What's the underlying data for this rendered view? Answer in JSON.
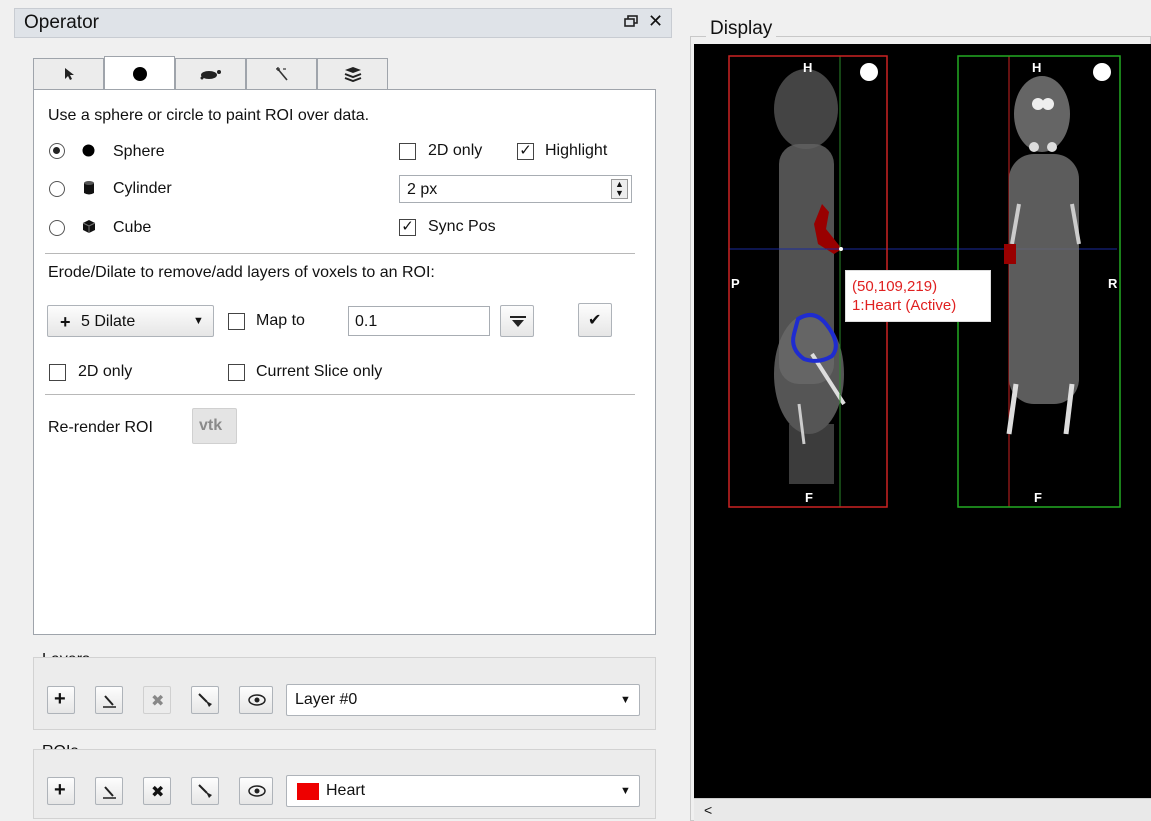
{
  "operator": {
    "title": "Operator",
    "float_icon": "ᴕ",
    "close_icon": "✕",
    "tabs": [
      "pointer-icon",
      "sphere-brush-icon",
      "pen-icon",
      "wand-icon",
      "layers-stack-icon"
    ],
    "paint_desc": "Use a sphere or circle to paint ROI over data.",
    "shapes": [
      {
        "label": "Sphere",
        "checked": true,
        "icon": "sphere-icon"
      },
      {
        "label": "Cylinder",
        "checked": false,
        "icon": "cylinder-icon"
      },
      {
        "label": "Cube",
        "checked": false,
        "icon": "cube-icon"
      }
    ],
    "two_d_only_label": "2D only",
    "highlight_label": "Highlight",
    "size_value": "2 px",
    "sync_pos_label": "Sync Pos",
    "erode_desc": "Erode/Dilate to remove/add layers of voxels to an ROI:",
    "dilate_label": "5 Dilate",
    "map_to_label": "Map to",
    "map_value": "0.1",
    "two_d_only_2_label": "2D only",
    "current_slice_label": "Current Slice only",
    "rerender_label": "Re-render ROI",
    "vtk_label": "vtk"
  },
  "layers": {
    "title": "Layers",
    "selected": "Layer #0"
  },
  "rois": {
    "title": "ROIs",
    "selected": "Heart",
    "color": "#ee0000"
  },
  "display": {
    "title": "Display",
    "left_view": {
      "top": "H",
      "bottom": "F",
      "left": "P",
      "border_color": "#cc2222"
    },
    "right_view": {
      "top": "H",
      "bottom": "F",
      "right": "R",
      "border_color": "#22aa22"
    },
    "tooltip_coords": "(50,109,219)",
    "tooltip_label": "1:Heart (Active)",
    "scroll_left": "<"
  }
}
